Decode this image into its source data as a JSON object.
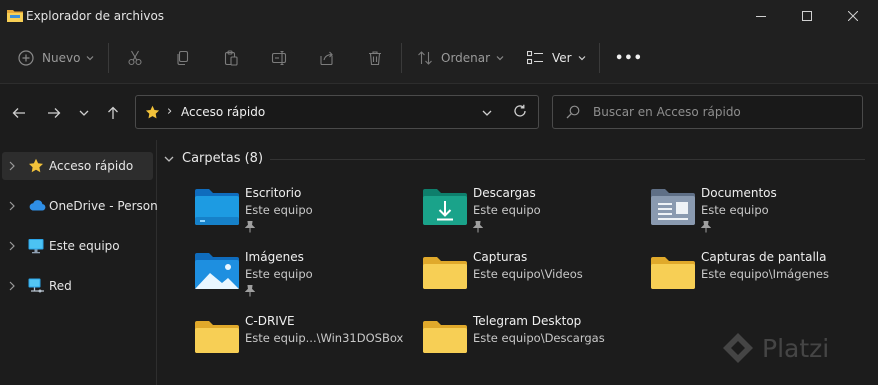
{
  "window": {
    "title": "Explorador de archivos"
  },
  "command_bar": {
    "new_label": "Nuevo",
    "sort_label": "Ordenar",
    "view_label": "Ver",
    "more_label": "•••",
    "icons": [
      "cut-icon",
      "copy-icon",
      "paste-icon",
      "rename-icon",
      "share-icon",
      "delete-icon"
    ]
  },
  "address": {
    "breadcrumb": "Acceso rápido",
    "separator": "›",
    "search_placeholder": "Buscar en Acceso rápido"
  },
  "sidebar": {
    "items": [
      {
        "label": "Acceso rápido",
        "icon": "star-icon",
        "selected": true
      },
      {
        "label": "OneDrive - Personal",
        "icon": "cloud-icon",
        "selected": false
      },
      {
        "label": "Este equipo",
        "icon": "monitor-icon",
        "selected": false
      },
      {
        "label": "Red",
        "icon": "network-icon",
        "selected": false
      }
    ]
  },
  "main": {
    "section_title": "Carpetas (8)",
    "folders": [
      {
        "name": "Escritorio",
        "location": "Este equipo",
        "pinned": true,
        "icon": "desktop-folder-icon",
        "color": "#1a8fd6"
      },
      {
        "name": "Descargas",
        "location": "Este equipo",
        "pinned": true,
        "icon": "downloads-folder-icon",
        "color": "#1aa38a"
      },
      {
        "name": "Documentos",
        "location": "Este equipo",
        "pinned": true,
        "icon": "documents-folder-icon",
        "color": "#8294ad"
      },
      {
        "name": "Imágenes",
        "location": "Este equipo",
        "pinned": true,
        "icon": "pictures-folder-icon",
        "color": "#1e8fe0"
      },
      {
        "name": "Capturas",
        "location": "Este equipo\\Videos",
        "pinned": false,
        "icon": "folder-icon",
        "color": "#f4c343"
      },
      {
        "name": "Capturas de pantalla",
        "location": "Este equipo\\Imágenes",
        "pinned": false,
        "icon": "folder-icon",
        "color": "#f4c343"
      },
      {
        "name": "C-DRIVE",
        "location": "Este equip...\\Win31DOSBox",
        "pinned": false,
        "icon": "folder-icon",
        "color": "#f4c343"
      },
      {
        "name": "Telegram Desktop",
        "location": "Este equipo\\Descargas",
        "pinned": false,
        "icon": "folder-icon",
        "color": "#f4c343"
      }
    ]
  },
  "watermark": {
    "text": "Platzi"
  },
  "colors": {
    "background": "#1c1c1c",
    "accent_star": "#f2c23a",
    "folder_yellow": "#f4c343"
  }
}
